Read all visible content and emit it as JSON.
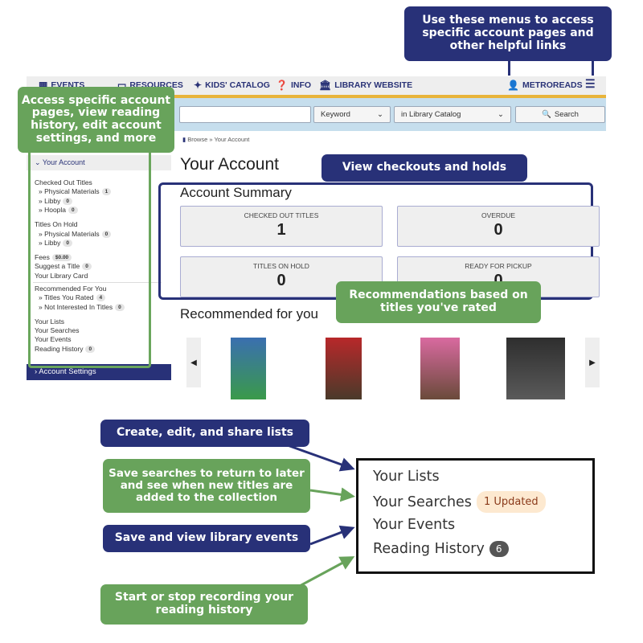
{
  "nav": {
    "items": [
      {
        "label": "EVENTS",
        "icon": "calendar-icon"
      },
      {
        "label": "RESOURCES",
        "icon": "monitor-icon"
      },
      {
        "label": "KIDS' CATALOG",
        "icon": "child-icon"
      },
      {
        "label": "INFO",
        "icon": "question-circle-icon"
      },
      {
        "label": "LIBRARY WEBSITE",
        "icon": "institution-icon"
      }
    ],
    "account": "METROREADS",
    "menu_icon": "hamburger-icon"
  },
  "search": {
    "query": "",
    "type": "Keyword",
    "scope": "in Library Catalog",
    "button": "Search"
  },
  "breadcrumb": {
    "browse": "Browse",
    "current": "» Your Account"
  },
  "sidebar": {
    "header": "Your Account",
    "checked_out": {
      "label": "Checked Out Titles",
      "items": [
        {
          "label": "» Physical Materials",
          "count": "1"
        },
        {
          "label": "» Libby",
          "count": "0"
        },
        {
          "label": "» Hoopla",
          "count": "0"
        }
      ]
    },
    "holds": {
      "label": "Titles On Hold",
      "items": [
        {
          "label": "» Physical Materials",
          "count": "0"
        },
        {
          "label": "» Libby",
          "count": "0"
        }
      ]
    },
    "fees": {
      "label": "Fees",
      "count": "$0.00"
    },
    "suggest": {
      "label": "Suggest a Title",
      "count": "0"
    },
    "card": "Your Library Card",
    "recommended": {
      "label": "Recommended For You",
      "items": [
        {
          "label": "» Titles You Rated",
          "count": "4"
        },
        {
          "label": "» Not Interested In Titles",
          "count": "0"
        }
      ]
    },
    "lists": "Your Lists",
    "searches": "Your Searches",
    "events": "Your Events",
    "history": {
      "label": "Reading History",
      "count": "0"
    },
    "settings": "Account Settings"
  },
  "main": {
    "title": "Your Account",
    "summary_title": "Account Summary",
    "cards": [
      {
        "label": "CHECKED OUT TITLES",
        "value": "1"
      },
      {
        "label": "OVERDUE",
        "value": "0"
      },
      {
        "label": "TITLES ON HOLD",
        "value": "0"
      },
      {
        "label": "READY FOR PICKUP",
        "value": "0"
      }
    ],
    "recommended_title": "Recommended for you",
    "books": [
      {
        "cover_color": "#3a6fb0"
      },
      {
        "cover_color": "#b8282a"
      },
      {
        "cover_color": "#d96aa0"
      },
      {
        "cover_color": "#2e2e2e"
      }
    ]
  },
  "zoomed": {
    "lists": "Your Lists",
    "searches": "Your Searches",
    "searches_badge": "1 Updated",
    "events": "Your Events",
    "history": "Reading History",
    "history_count": "6"
  },
  "callouts": {
    "menus": "Use these menus to access specific account pages and other helpful links",
    "sidebar": "Access specific account pages, view reading history, edit account settings, and more",
    "checkouts": "View checkouts and holds",
    "recommendations": "Recommendations based on titles you've rated",
    "lists": "Create, edit, and share lists",
    "searches": "Save searches to return to later and see when new titles are added to the collection",
    "events": "Save and view library events",
    "history": "Start or stop recording your reading history"
  },
  "colors": {
    "navy": "#283178",
    "green": "#68a35b",
    "yellow": "#e8b43a"
  }
}
